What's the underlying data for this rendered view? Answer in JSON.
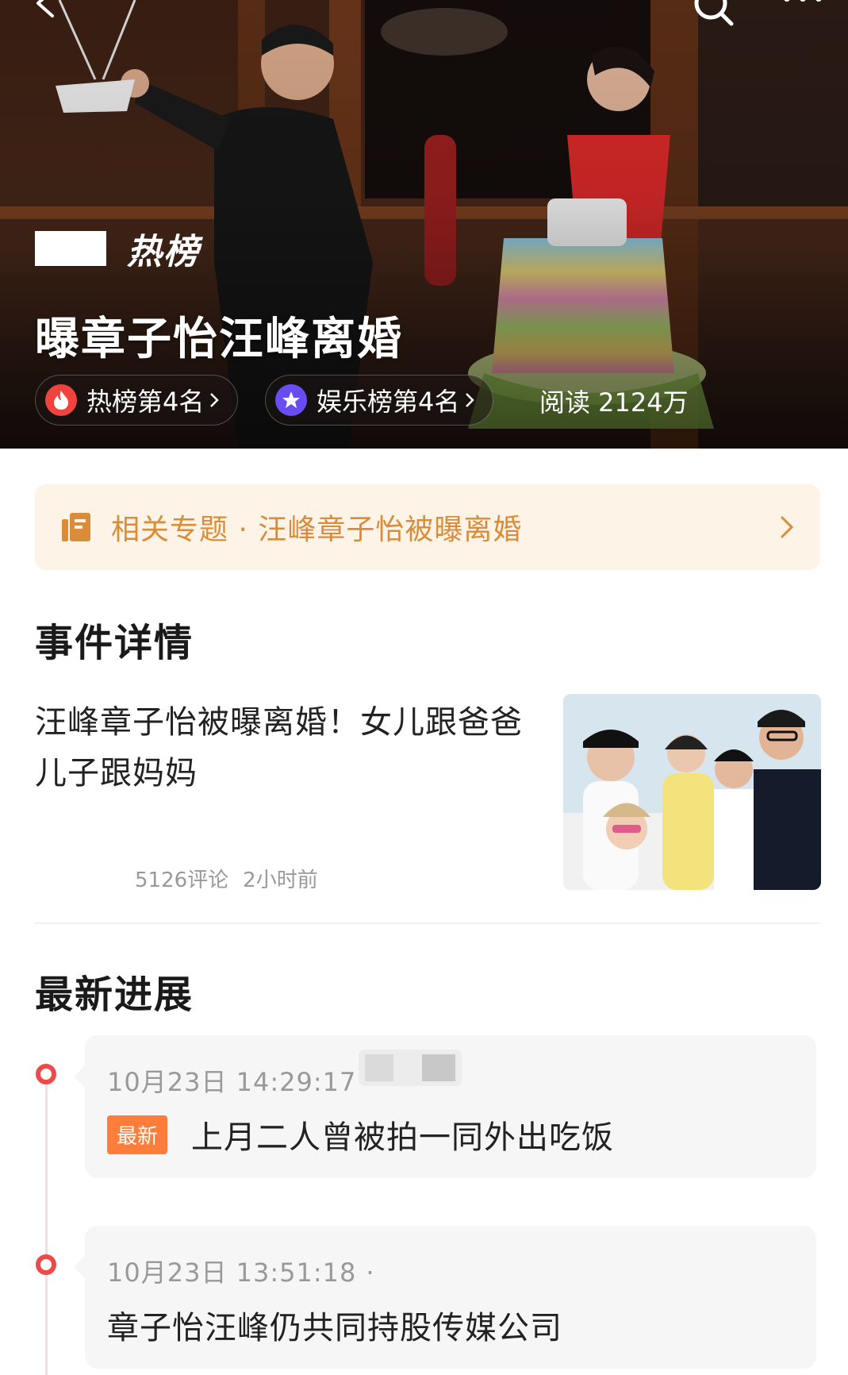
{
  "header": {
    "icons": [
      "back-icon",
      "search-icon",
      "more-icon"
    ],
    "logo_text": "热榜",
    "title": "曝章子怡汪峰离婚",
    "rank_hot": "热榜第4名",
    "rank_ent": "娱乐榜第4名",
    "read_count": "阅读 2124万"
  },
  "topic": {
    "label": "相关专题 · 汪峰章子怡被曝离婚",
    "color": "#d98d3a"
  },
  "detail": {
    "section_title": "事件详情",
    "news_title": "汪峰章子怡被曝离婚！女儿跟爸爸儿子跟妈妈",
    "comments": "5126评论",
    "time_ago": "2小时前"
  },
  "progress": {
    "section_title": "最新进展",
    "items": [
      {
        "time": "10月23日 14:29:17",
        "separator": "·",
        "badge": "最新",
        "text": "上月二人曾被拍一同外出吃饭"
      },
      {
        "time": "10月23日 13:51:18",
        "separator": "·",
        "text": "章子怡汪峰仍共同持股传媒公司"
      }
    ]
  },
  "colors": {
    "accent_red": "#ee4a4a",
    "badge_orange": "#ff7d3a",
    "topic_bg": "#fdf3e6"
  }
}
